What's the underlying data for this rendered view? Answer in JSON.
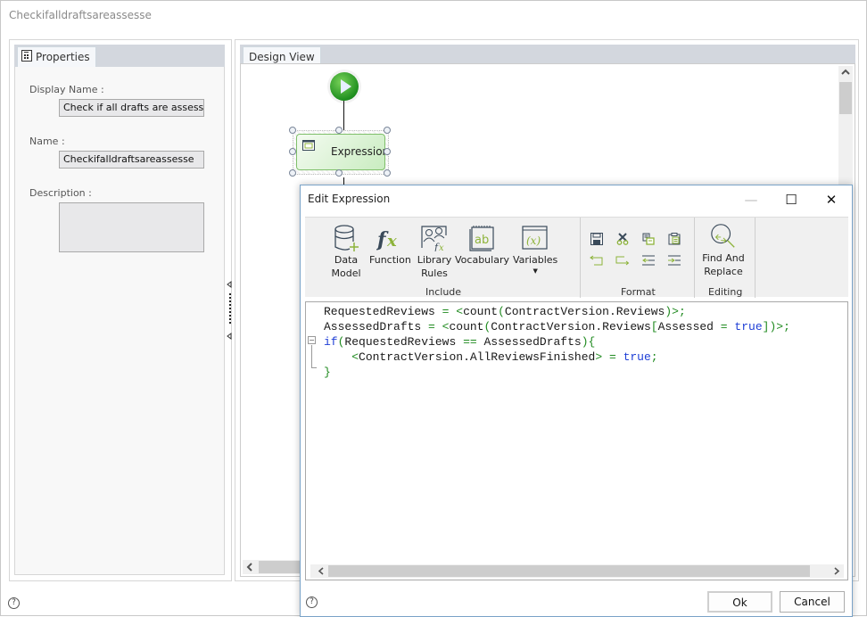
{
  "window": {
    "title": "Checkifalldraftsareassesse"
  },
  "properties": {
    "tab_label": "Properties",
    "display_name_label": "Display Name :",
    "display_name_value": "Check if all drafts are assessed",
    "name_label": "Name :",
    "name_value": "Checkifalldraftsareassesse",
    "description_label": "Description :",
    "description_value": ""
  },
  "design": {
    "tab_label": "Design View",
    "node_label": "Expression"
  },
  "dialog": {
    "title": "Edit Expression",
    "minimize_glyph": "—",
    "maximize_glyph": "☐",
    "close_glyph": "✕",
    "ribbon": {
      "include": {
        "group_label": "Include",
        "buttons": [
          {
            "label": "Data Model",
            "icon": "database-add-icon"
          },
          {
            "label": "Function",
            "icon": "function-fx-icon"
          },
          {
            "label": "Library Rules",
            "icon": "library-rules-icon"
          },
          {
            "label": "Vocabulary",
            "icon": "vocabulary-icon"
          },
          {
            "label": "Variables",
            "icon": "variables-icon",
            "has_dropdown": true
          }
        ]
      },
      "format": {
        "group_label": "Format",
        "buttons": [
          {
            "icon": "save-icon"
          },
          {
            "icon": "cut-icon"
          },
          {
            "icon": "copy-icon"
          },
          {
            "icon": "paste-icon"
          },
          {
            "icon": "undo-icon"
          },
          {
            "icon": "redo-icon"
          },
          {
            "icon": "outdent-icon"
          },
          {
            "icon": "indent-icon"
          }
        ]
      },
      "editing": {
        "group_label": "Editing",
        "buttons": [
          {
            "label": "Find And Replace",
            "icon": "find-replace-icon"
          }
        ]
      }
    },
    "code_lines": [
      "RequestedReviews = <count(ContractVersion.Reviews)>;",
      "AssessedDrafts = <count(ContractVersion.Reviews[Assessed = true])>;",
      "if(RequestedReviews == AssessedDrafts){",
      "    <ContractVersion.AllReviewsFinished> = true;",
      "}"
    ],
    "ok_label": "Ok",
    "cancel_label": "Cancel"
  },
  "colors": {
    "code_operator": "#1f8a1f",
    "code_keyword": "#1f3fd6",
    "icon_accent": "#8db33a",
    "icon_dark": "#3a4a5a"
  }
}
